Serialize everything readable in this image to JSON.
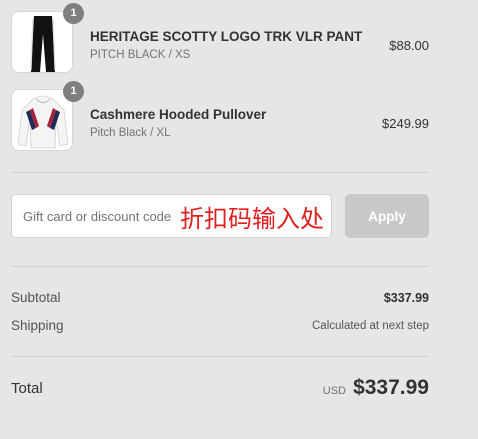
{
  "items": [
    {
      "quantity": "1",
      "name": "HERITAGE SCOTTY LOGO TRK VLR PANT",
      "variant": "PITCH BLACK / XS",
      "price": "$88.00",
      "image_icon": "track-pants-icon"
    },
    {
      "quantity": "1",
      "name": "Cashmere Hooded Pullover",
      "variant": "Pitch Black / XL",
      "price": "$249.99",
      "image_icon": "hooded-pullover-icon"
    }
  ],
  "discount": {
    "placeholder": "Gift card or discount code",
    "annotation": "折扣码输入处",
    "apply_label": "Apply"
  },
  "summary": {
    "subtotal_label": "Subtotal",
    "subtotal_value": "$337.99",
    "shipping_label": "Shipping",
    "shipping_value": "Calculated at next step"
  },
  "total": {
    "label": "Total",
    "currency": "USD",
    "amount": "$337.99"
  },
  "colors": {
    "background": "#e6e6e6",
    "badge": "#7f7f7f",
    "apply_button": "#c8c8c8",
    "annotation": "#e02020"
  }
}
